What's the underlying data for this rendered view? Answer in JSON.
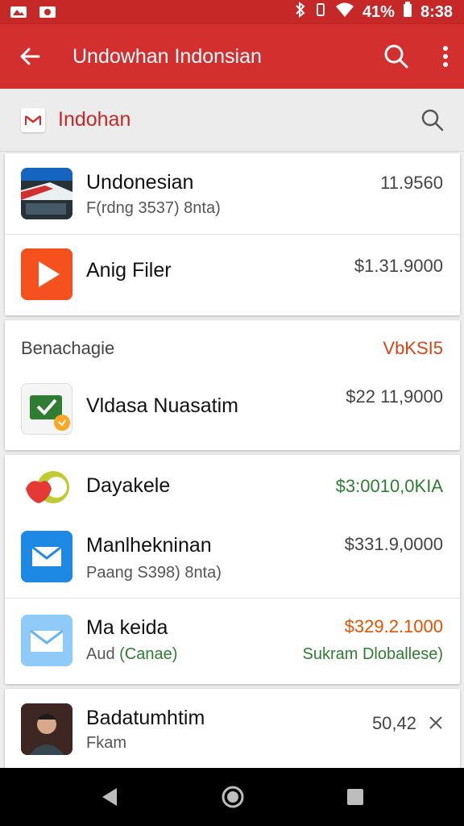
{
  "colors": {
    "brand_red": "#d32f2f",
    "status_red": "#c62828",
    "green": "#2e7d32",
    "orange_text": "#e65100"
  },
  "status_bar": {
    "battery": "41%",
    "time": "8:38"
  },
  "app_bar": {
    "title": "Undowhan Indonsian"
  },
  "search": {
    "placeholder": "Indohan"
  },
  "card1": {
    "items": [
      {
        "title": "Undonesian",
        "subtitle": "F(rdng 3537) 8nta)",
        "amount": "11.9560",
        "icon": "news-photo-icon"
      },
      {
        "title": "Anig Filer",
        "subtitle": "",
        "amount": "$1.31.9000",
        "icon": "play-icon"
      }
    ]
  },
  "card2": {
    "section_title": "Benachagie",
    "section_value": "VbKSI5",
    "items": [
      {
        "title": "Vldasa Nuasatim",
        "amount": "$22 11,9000",
        "icon": "checkmark-mail-icon"
      }
    ]
  },
  "card3": {
    "items": [
      {
        "title": "Dayakele",
        "amount": "$3:0010,0KIA",
        "icon": "fruit-icon"
      },
      {
        "title": "Manlhekninan",
        "subtitle": "Paang S398) 8nta)",
        "amount": "$331.9,0000",
        "icon": "mail-icon"
      },
      {
        "title": "Ma keida",
        "subtitle_plain": "Aud",
        "subtitle_green": "(Canae)",
        "amount": "$329.2.1000",
        "amount_sub": "Sukram Dloballese)",
        "icon": "envelope-icon"
      }
    ]
  },
  "card4": {
    "items": [
      {
        "title": "Badatumhtim",
        "subtitle": "Fkam",
        "amount": "50,42",
        "icon": "person-photo-icon"
      }
    ]
  },
  "nav": {
    "back": "back-icon",
    "home": "home-icon",
    "recents": "recents-icon"
  }
}
